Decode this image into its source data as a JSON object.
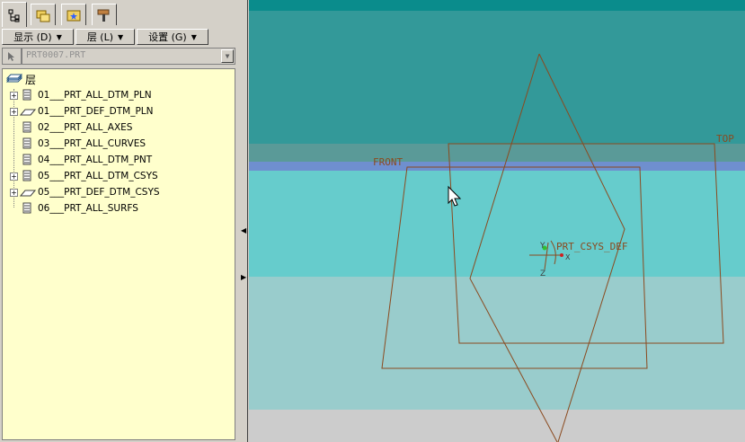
{
  "tabs": [
    {
      "name": "model-tree-tab",
      "icon": "tree-icon"
    },
    {
      "name": "folder-browser-tab",
      "icon": "folders-icon"
    },
    {
      "name": "favorites-tab",
      "icon": "star-folder-icon"
    },
    {
      "name": "connections-tab",
      "icon": "hammer-icon"
    }
  ],
  "menus": {
    "display": "显示 (D)",
    "layer": "层 (L)",
    "settings": "设置 (G)"
  },
  "model": {
    "name": "PRT0007.PRT"
  },
  "tree": {
    "root_label": "层",
    "items": [
      {
        "label": "01___PRT_ALL_DTM_PLN",
        "expandable": true,
        "icon": "layer-icon"
      },
      {
        "label": "01___PRT_DEF_DTM_PLN",
        "expandable": true,
        "icon": "plane-icon"
      },
      {
        "label": "02___PRT_ALL_AXES",
        "expandable": false,
        "icon": "layer-icon"
      },
      {
        "label": "03___PRT_ALL_CURVES",
        "expandable": false,
        "icon": "layer-icon"
      },
      {
        "label": "04___PRT_ALL_DTM_PNT",
        "expandable": false,
        "icon": "layer-icon"
      },
      {
        "label": "05___PRT_ALL_DTM_CSYS",
        "expandable": true,
        "icon": "layer-icon"
      },
      {
        "label": "05___PRT_DEF_DTM_CSYS",
        "expandable": true,
        "icon": "plane-icon"
      },
      {
        "label": "06___PRT_ALL_SURFS",
        "expandable": false,
        "icon": "layer-icon"
      }
    ]
  },
  "viewport": {
    "labels": {
      "front": "FRONT",
      "top": "TOP",
      "csys": "PRT_CSYS_DEF",
      "axis_x": "X",
      "axis_y": "Y",
      "axis_z": "Z"
    },
    "colors": {
      "datum_line": "#8b4a1f",
      "band1": "#0a8c8c",
      "band2": "#339999",
      "band3": "#5a9a98",
      "band4": "#6f8fcf",
      "band5": "#66cccc",
      "band6": "#99cccc",
      "band7": "#cccccc"
    }
  }
}
